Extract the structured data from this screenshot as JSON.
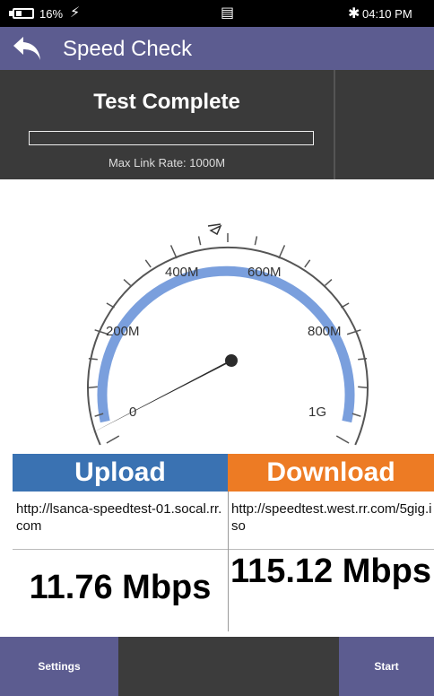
{
  "status_bar": {
    "battery_percent": "16%",
    "time": "04:10 PM",
    "icons": [
      "battery-icon",
      "charging-bolt-icon",
      "notification-icon",
      "bluetooth-icon"
    ]
  },
  "header": {
    "title": "Speed Check",
    "back_icon": "back-arrow-icon",
    "color": "#5c5c90"
  },
  "test_status": {
    "headline": "Test Complete",
    "progress": 0,
    "max_link_rate": "Max Link Rate: 1000M"
  },
  "gauge": {
    "labels": [
      "0",
      "200M",
      "400M",
      "600M",
      "800M",
      "1G"
    ],
    "max_mbps": 1000,
    "needle_value_mbps": 115.12,
    "arc_color": "#7a9fdd",
    "peak_marker_icon": "peak-marker-icon"
  },
  "results": {
    "upload": {
      "label": "Upload",
      "url": "http://lsanca-speedtest-01.socal.rr.com",
      "speed": "11.76 Mbps",
      "color": "#3a72b2"
    },
    "download": {
      "label": "Download",
      "url": "http://speedtest.west.rr.com/5gig.iso",
      "speed": "115.12 Mbps",
      "color": "#ed7b24"
    }
  },
  "bottom_bar": {
    "settings_label": "Settings",
    "start_label": "Start"
  }
}
